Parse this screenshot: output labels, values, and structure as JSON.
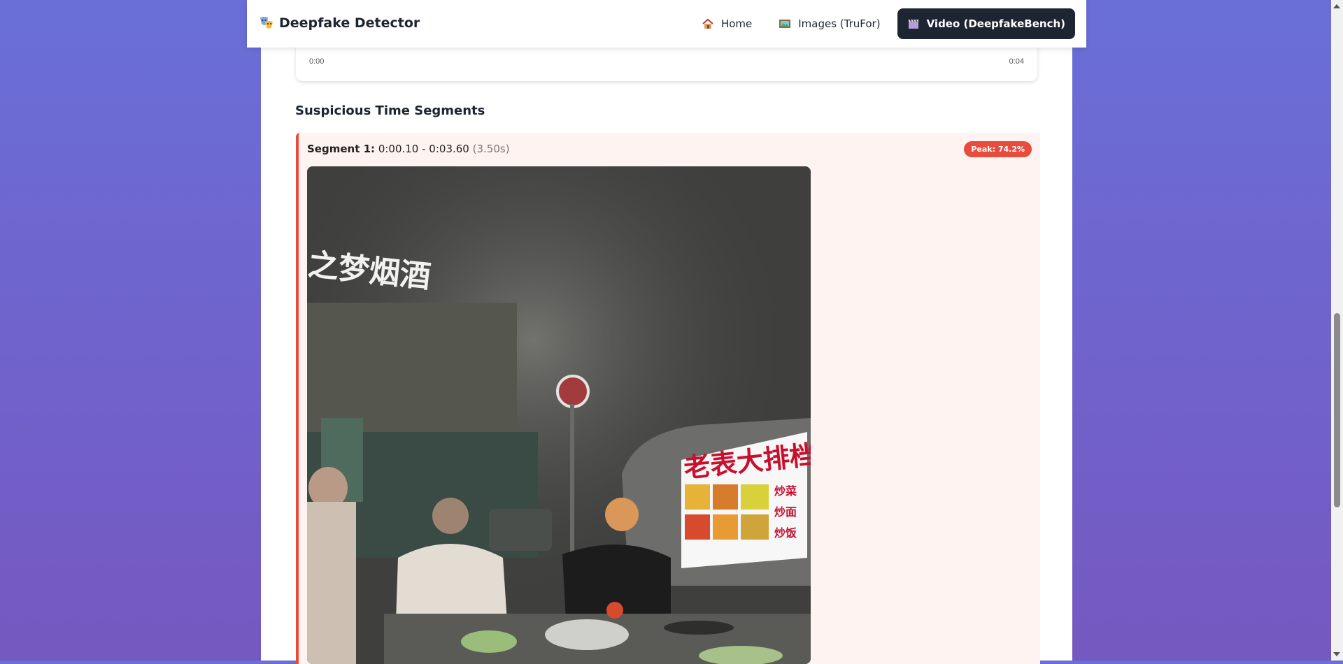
{
  "app": {
    "title": "Deepfake Detector",
    "logo_icon": "theater-masks-icon"
  },
  "nav": {
    "items": [
      {
        "label": "Home",
        "icon": "house-icon",
        "active": false
      },
      {
        "label": "Images (TruFor)",
        "icon": "framed-picture-icon",
        "active": false
      },
      {
        "label": "Video (DeepfakeBench)",
        "icon": "clapper-board-icon",
        "active": true
      }
    ]
  },
  "timeline": {
    "start_label": "0:00",
    "end_label": "0:04"
  },
  "section": {
    "title": "Suspicious Time Segments"
  },
  "segment": {
    "label": "Segment 1:",
    "range": "0:00.10 - 0:03.60",
    "duration": "(3.50s)",
    "peak": "Peak: 74.2%",
    "frame_signs": {
      "top_sign": "之梦烟酒",
      "shop_sign": "老表大排档",
      "menu_1": "炒菜",
      "menu_2": "炒面",
      "menu_3": "炒饭"
    }
  },
  "colors": {
    "accent": "#e74c3c",
    "nav_active_bg": "#1e2532",
    "segment_bg": "#fff3f1"
  }
}
